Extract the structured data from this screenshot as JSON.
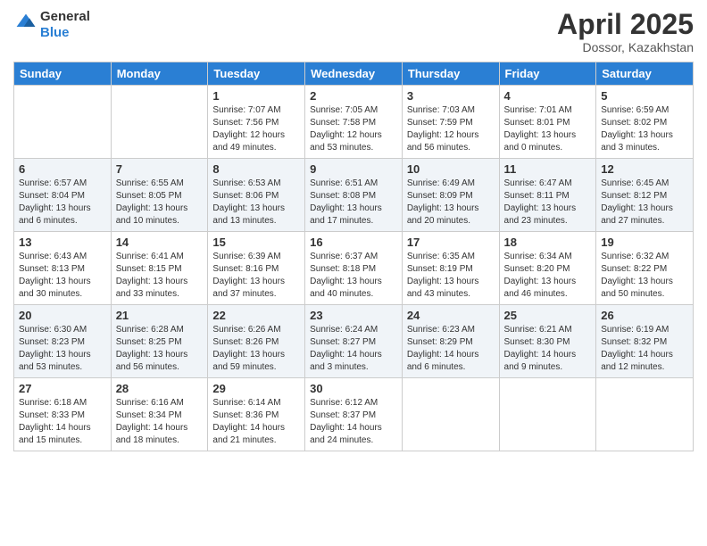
{
  "logo": {
    "line1": "General",
    "line2": "Blue"
  },
  "title": "April 2025",
  "location": "Dossor, Kazakhstan",
  "weekdays": [
    "Sunday",
    "Monday",
    "Tuesday",
    "Wednesday",
    "Thursday",
    "Friday",
    "Saturday"
  ],
  "weeks": [
    [
      {
        "day": "",
        "info": ""
      },
      {
        "day": "",
        "info": ""
      },
      {
        "day": "1",
        "info": "Sunrise: 7:07 AM\nSunset: 7:56 PM\nDaylight: 12 hours and 49 minutes."
      },
      {
        "day": "2",
        "info": "Sunrise: 7:05 AM\nSunset: 7:58 PM\nDaylight: 12 hours and 53 minutes."
      },
      {
        "day": "3",
        "info": "Sunrise: 7:03 AM\nSunset: 7:59 PM\nDaylight: 12 hours and 56 minutes."
      },
      {
        "day": "4",
        "info": "Sunrise: 7:01 AM\nSunset: 8:01 PM\nDaylight: 13 hours and 0 minutes."
      },
      {
        "day": "5",
        "info": "Sunrise: 6:59 AM\nSunset: 8:02 PM\nDaylight: 13 hours and 3 minutes."
      }
    ],
    [
      {
        "day": "6",
        "info": "Sunrise: 6:57 AM\nSunset: 8:04 PM\nDaylight: 13 hours and 6 minutes."
      },
      {
        "day": "7",
        "info": "Sunrise: 6:55 AM\nSunset: 8:05 PM\nDaylight: 13 hours and 10 minutes."
      },
      {
        "day": "8",
        "info": "Sunrise: 6:53 AM\nSunset: 8:06 PM\nDaylight: 13 hours and 13 minutes."
      },
      {
        "day": "9",
        "info": "Sunrise: 6:51 AM\nSunset: 8:08 PM\nDaylight: 13 hours and 17 minutes."
      },
      {
        "day": "10",
        "info": "Sunrise: 6:49 AM\nSunset: 8:09 PM\nDaylight: 13 hours and 20 minutes."
      },
      {
        "day": "11",
        "info": "Sunrise: 6:47 AM\nSunset: 8:11 PM\nDaylight: 13 hours and 23 minutes."
      },
      {
        "day": "12",
        "info": "Sunrise: 6:45 AM\nSunset: 8:12 PM\nDaylight: 13 hours and 27 minutes."
      }
    ],
    [
      {
        "day": "13",
        "info": "Sunrise: 6:43 AM\nSunset: 8:13 PM\nDaylight: 13 hours and 30 minutes."
      },
      {
        "day": "14",
        "info": "Sunrise: 6:41 AM\nSunset: 8:15 PM\nDaylight: 13 hours and 33 minutes."
      },
      {
        "day": "15",
        "info": "Sunrise: 6:39 AM\nSunset: 8:16 PM\nDaylight: 13 hours and 37 minutes."
      },
      {
        "day": "16",
        "info": "Sunrise: 6:37 AM\nSunset: 8:18 PM\nDaylight: 13 hours and 40 minutes."
      },
      {
        "day": "17",
        "info": "Sunrise: 6:35 AM\nSunset: 8:19 PM\nDaylight: 13 hours and 43 minutes."
      },
      {
        "day": "18",
        "info": "Sunrise: 6:34 AM\nSunset: 8:20 PM\nDaylight: 13 hours and 46 minutes."
      },
      {
        "day": "19",
        "info": "Sunrise: 6:32 AM\nSunset: 8:22 PM\nDaylight: 13 hours and 50 minutes."
      }
    ],
    [
      {
        "day": "20",
        "info": "Sunrise: 6:30 AM\nSunset: 8:23 PM\nDaylight: 13 hours and 53 minutes."
      },
      {
        "day": "21",
        "info": "Sunrise: 6:28 AM\nSunset: 8:25 PM\nDaylight: 13 hours and 56 minutes."
      },
      {
        "day": "22",
        "info": "Sunrise: 6:26 AM\nSunset: 8:26 PM\nDaylight: 13 hours and 59 minutes."
      },
      {
        "day": "23",
        "info": "Sunrise: 6:24 AM\nSunset: 8:27 PM\nDaylight: 14 hours and 3 minutes."
      },
      {
        "day": "24",
        "info": "Sunrise: 6:23 AM\nSunset: 8:29 PM\nDaylight: 14 hours and 6 minutes."
      },
      {
        "day": "25",
        "info": "Sunrise: 6:21 AM\nSunset: 8:30 PM\nDaylight: 14 hours and 9 minutes."
      },
      {
        "day": "26",
        "info": "Sunrise: 6:19 AM\nSunset: 8:32 PM\nDaylight: 14 hours and 12 minutes."
      }
    ],
    [
      {
        "day": "27",
        "info": "Sunrise: 6:18 AM\nSunset: 8:33 PM\nDaylight: 14 hours and 15 minutes."
      },
      {
        "day": "28",
        "info": "Sunrise: 6:16 AM\nSunset: 8:34 PM\nDaylight: 14 hours and 18 minutes."
      },
      {
        "day": "29",
        "info": "Sunrise: 6:14 AM\nSunset: 8:36 PM\nDaylight: 14 hours and 21 minutes."
      },
      {
        "day": "30",
        "info": "Sunrise: 6:12 AM\nSunset: 8:37 PM\nDaylight: 14 hours and 24 minutes."
      },
      {
        "day": "",
        "info": ""
      },
      {
        "day": "",
        "info": ""
      },
      {
        "day": "",
        "info": ""
      }
    ]
  ]
}
